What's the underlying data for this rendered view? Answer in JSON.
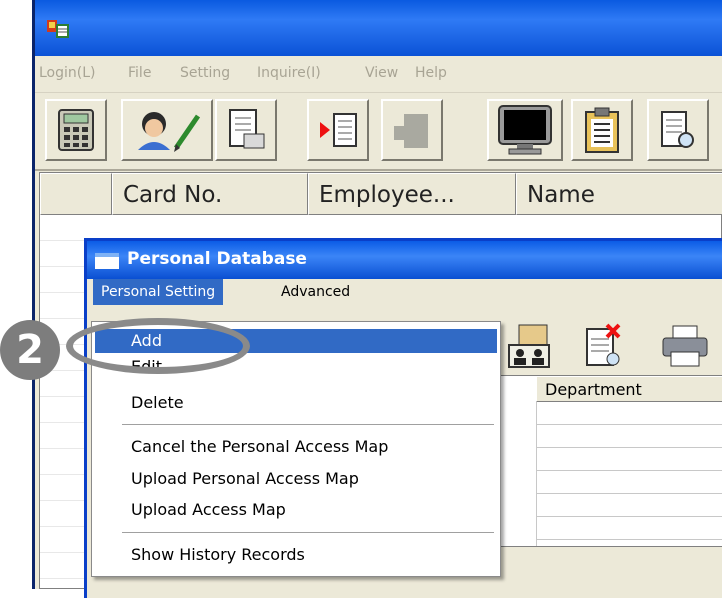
{
  "main_window": {
    "menu": [
      "Login(L)",
      "File",
      "Setting",
      "Inquire(I)",
      "View",
      "Help"
    ],
    "toolbar_icons": [
      "calculator-icon",
      "user-edit-icon",
      "document-card-icon",
      "play-document-icon",
      "card-disabled-icon",
      "monitor-icon",
      "clipboard-icon",
      "document-search-icon"
    ],
    "grid_headers": [
      "Card No.",
      "Employee...",
      "Name"
    ]
  },
  "dialog": {
    "title": "Personal Database",
    "menu": [
      "Personal Setting",
      "Advanced"
    ],
    "toolbar_icons": [
      "user-card-icon",
      "delete-document-icon",
      "printer-icon"
    ],
    "grid_header_department": "Department"
  },
  "dropdown": {
    "items_group1": [
      "Add",
      "Edit",
      "Delete"
    ],
    "items_group2": [
      "Cancel the Personal Access Map",
      "Upload Personal Access Map",
      "Upload Access Map"
    ],
    "items_group3": [
      "Show History Records"
    ],
    "selected": "Add"
  },
  "annotation": {
    "step_number": "2"
  },
  "colors": {
    "title_blue": "#0a5ae0",
    "menu_highlight": "#316ac5",
    "badge_gray": "#7d7d7d"
  }
}
